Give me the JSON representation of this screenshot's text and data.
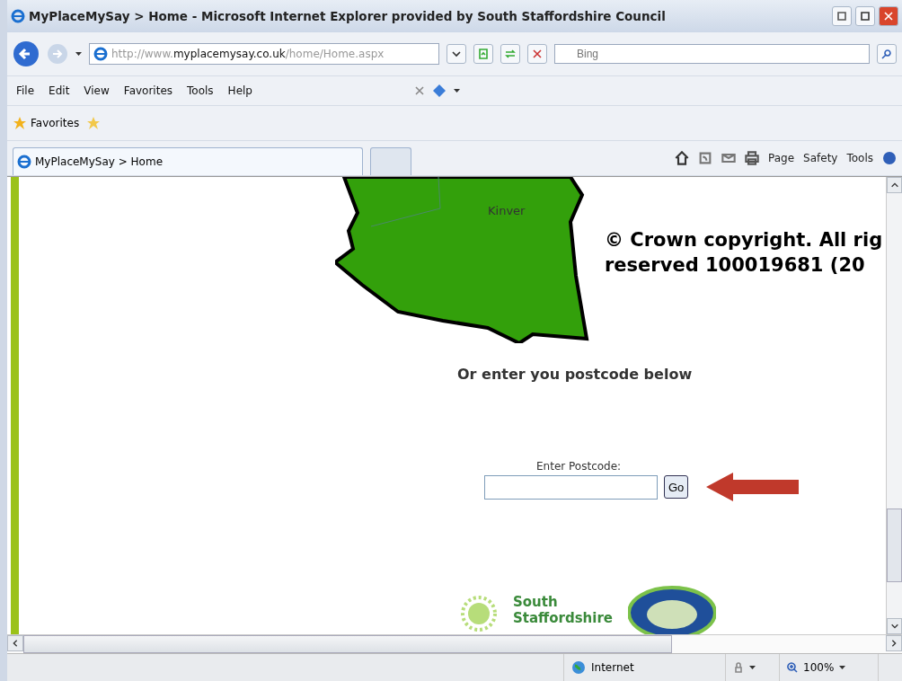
{
  "window": {
    "title": "MyPlaceMySay > Home - Microsoft Internet Explorer provided by South Staffordshire Council"
  },
  "address_bar": {
    "prefix": "http://www.",
    "domain": "myplacemysay.co.uk",
    "path": "/home/Home.aspx"
  },
  "search": {
    "placeholder": "Bing"
  },
  "menu": [
    "File",
    "Edit",
    "View",
    "Favorites",
    "Tools",
    "Help"
  ],
  "favorites_bar": {
    "label": "Favorites"
  },
  "tabs": [
    {
      "label": "MyPlaceMySay > Home",
      "selected": true
    }
  ],
  "command_bar": [
    "Page",
    "Safety",
    "Tools"
  ],
  "page": {
    "map_label": "Kinver",
    "copyright": [
      "© Crown copyright. All rig",
      "reserved 100019681 (20"
    ],
    "heading": "Or enter you postcode below",
    "postcode_label": "Enter Postcode:",
    "go_button": "Go",
    "council_logo": [
      "South",
      "Staffordshire"
    ]
  },
  "status_bar": {
    "zone": "Internet",
    "zoom": "100%"
  }
}
